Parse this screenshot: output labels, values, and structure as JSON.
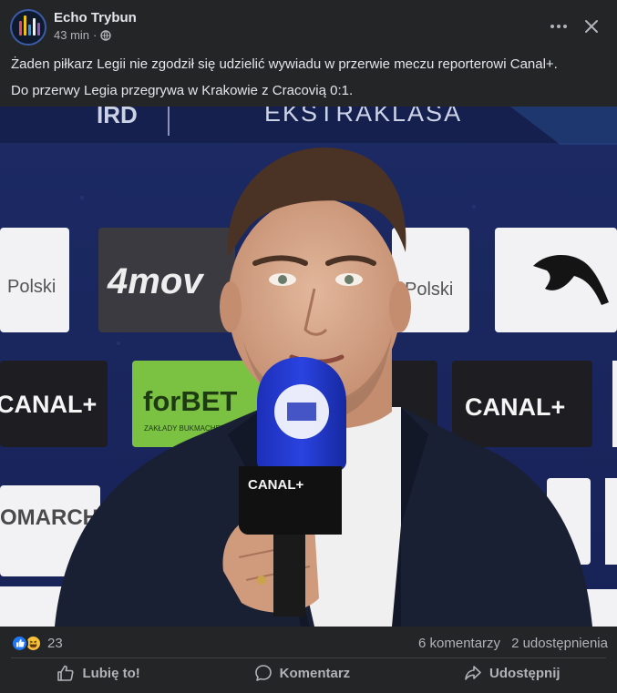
{
  "post": {
    "author": "Echo Trybun",
    "time": "43 min",
    "time_separator": "·",
    "privacy_icon": "globe-icon",
    "paragraphs": [
      "Żaden piłkarz Legii nie zgodził się udzielić wywiadu w przerwie meczu reporterowi Canal+.",
      "Do przerwy Legia przegrywa w Krakowie z Cracovią 0:1."
    ]
  },
  "photo": {
    "sponsor_texts": {
      "top_banner": "EKSTRAKLASA",
      "polski_left": "Polski",
      "polski_right": "Polski",
      "fourmove": "4mov",
      "canal_left": "CANAL+",
      "canal_right": "CANAL+",
      "forbet": "forBET",
      "forbet_sub": "ZAKŁADY BUKMACHERSKIE",
      "comarch": "OMARCH",
      "mic_flag": "CANAL+"
    }
  },
  "reactions": {
    "icons": [
      "like-icon",
      "haha-icon"
    ],
    "count": "23",
    "comments": "6 komentarzy",
    "shares": "2 udostępnienia"
  },
  "actions": {
    "like": "Lubię to!",
    "comment": "Komentarz",
    "share": "Udostępnij"
  },
  "colors": {
    "background": "#242526",
    "text_primary": "#e4e6eb",
    "text_secondary": "#b0b3b8",
    "like_blue": "#2078f4",
    "haha_yellow": "#f7c23a"
  }
}
